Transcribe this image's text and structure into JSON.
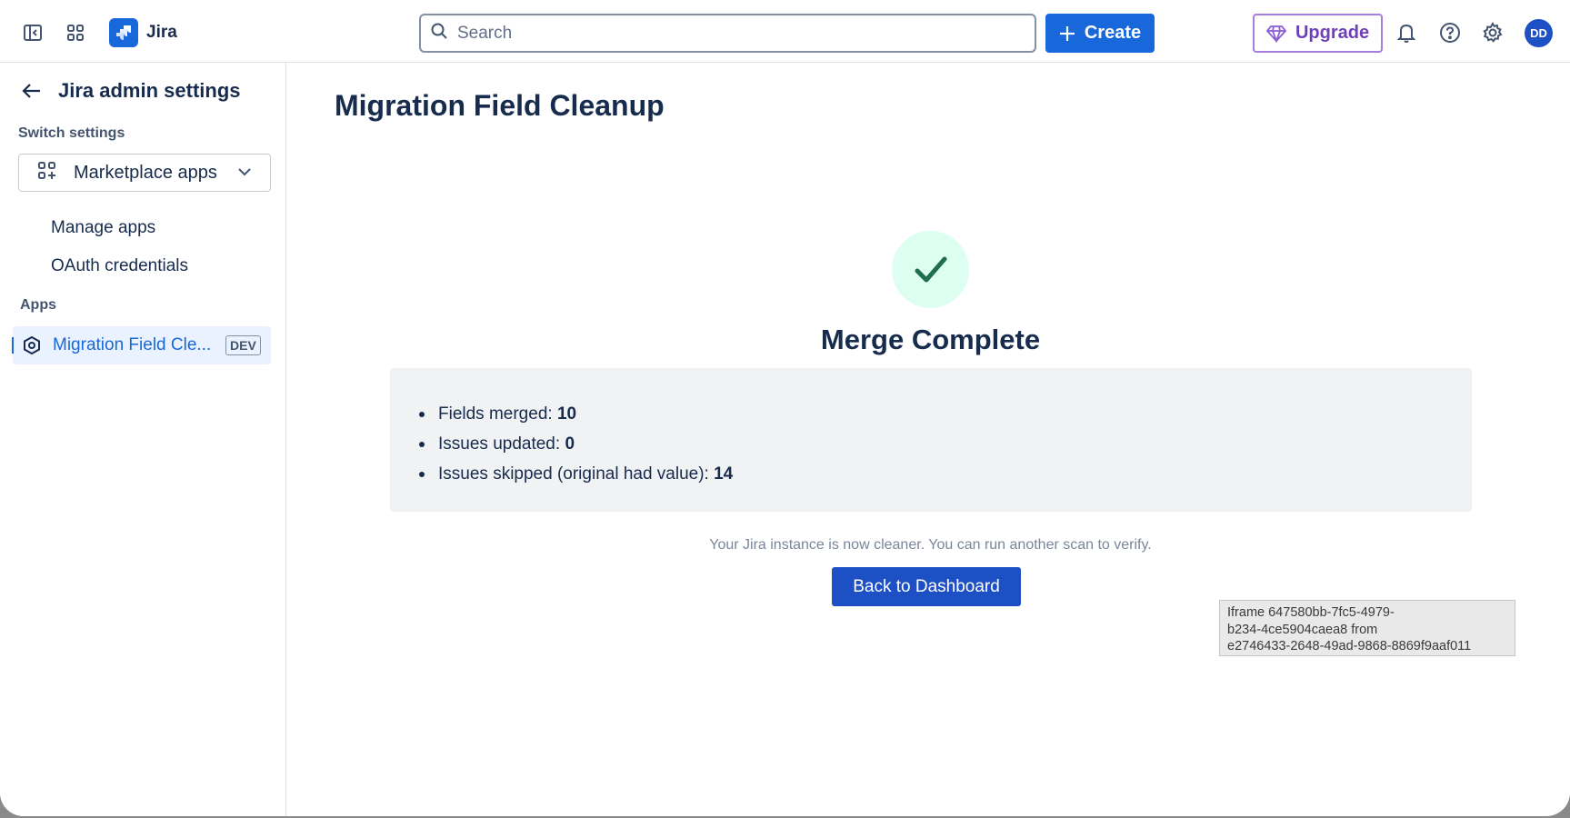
{
  "topbar": {
    "app_name": "Jira",
    "search_placeholder": "Search",
    "create_label": "Create",
    "upgrade_label": "Upgrade",
    "avatar_initials": "DD",
    "colors": {
      "primary": "#1868db",
      "upgrade": "#6e3fb8"
    }
  },
  "sidebar": {
    "title": "Jira admin settings",
    "switch_label": "Switch settings",
    "switch_value": "Marketplace apps",
    "items": [
      {
        "label": "Manage apps"
      },
      {
        "label": "OAuth credentials"
      }
    ],
    "apps_label": "Apps",
    "active_app": {
      "label": "Migration Field Cle...",
      "badge": "DEV"
    }
  },
  "main": {
    "title": "Migration Field Cleanup",
    "status_heading": "Merge Complete",
    "summary": [
      {
        "label": "Fields merged: ",
        "value": "10"
      },
      {
        "label": "Issues updated: ",
        "value": "0"
      },
      {
        "label": "Issues skipped (original had value): ",
        "value": "14"
      }
    ],
    "helper_text": "Your Jira instance is now cleaner. You can run another scan to verify.",
    "back_button": "Back to Dashboard"
  },
  "tooltip": {
    "line1": "Iframe 647580bb-7fc5-4979-",
    "line2": "b234-4ce5904caea8 from",
    "line3": "e2746433-2648-49ad-9868-8869f9aaf011"
  }
}
